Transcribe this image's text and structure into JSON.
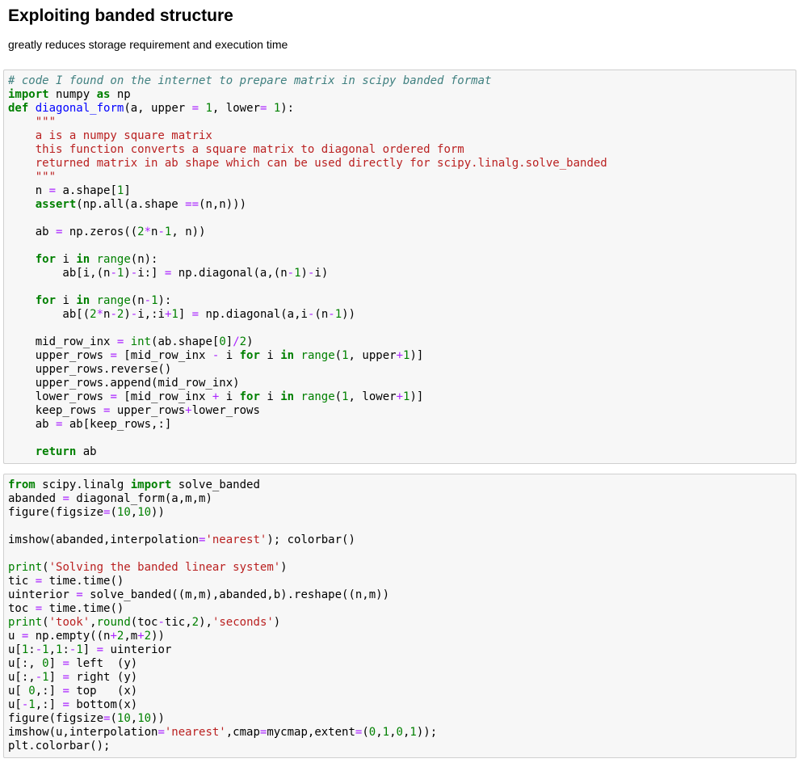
{
  "markdown": {
    "title": "Exploiting banded structure",
    "subtitle": "greatly reduces storage requirement and execution time"
  },
  "cells": [
    {
      "lines": [
        [
          [
            "cm",
            "# code I found on the internet to prepare matrix in scipy banded format"
          ]
        ],
        [
          [
            "kw",
            "import"
          ],
          [
            "",
            " numpy "
          ],
          [
            "kw",
            "as"
          ],
          [
            "",
            " np"
          ]
        ],
        [
          [
            "kw",
            "def"
          ],
          [
            "",
            " "
          ],
          [
            "fn",
            "diagonal_form"
          ],
          [
            "",
            "(a, upper "
          ],
          [
            "op",
            "="
          ],
          [
            "",
            " "
          ],
          [
            "num",
            "1"
          ],
          [
            "",
            ", lower"
          ],
          [
            "op",
            "="
          ],
          [
            "",
            " "
          ],
          [
            "num",
            "1"
          ],
          [
            "",
            "):"
          ]
        ],
        [
          [
            "",
            "    "
          ],
          [
            "str",
            "\"\"\""
          ]
        ],
        [
          [
            "str",
            "    a is a numpy square matrix"
          ]
        ],
        [
          [
            "str",
            "    this function converts a square matrix to diagonal ordered form"
          ]
        ],
        [
          [
            "str",
            "    returned matrix in ab shape which can be used directly for scipy.linalg.solve_banded"
          ]
        ],
        [
          [
            "str",
            "    \"\"\""
          ]
        ],
        [
          [
            "",
            "    n "
          ],
          [
            "op",
            "="
          ],
          [
            "",
            " a.shape["
          ],
          [
            "num",
            "1"
          ],
          [
            "",
            "]"
          ]
        ],
        [
          [
            "",
            "    "
          ],
          [
            "kw",
            "assert"
          ],
          [
            "",
            "(np.all(a.shape "
          ],
          [
            "op",
            "=="
          ],
          [
            "",
            "(n,n)))"
          ]
        ],
        [
          [
            "",
            ""
          ]
        ],
        [
          [
            "",
            "    ab "
          ],
          [
            "op",
            "="
          ],
          [
            "",
            " np.zeros(("
          ],
          [
            "num",
            "2"
          ],
          [
            "op",
            "*"
          ],
          [
            "",
            "n"
          ],
          [
            "op",
            "-"
          ],
          [
            "num",
            "1"
          ],
          [
            "",
            ", n))"
          ]
        ],
        [
          [
            "",
            ""
          ]
        ],
        [
          [
            "",
            "    "
          ],
          [
            "kw",
            "for"
          ],
          [
            "",
            " i "
          ],
          [
            "kw",
            "in"
          ],
          [
            "",
            " "
          ],
          [
            "bi",
            "range"
          ],
          [
            "",
            "(n):"
          ]
        ],
        [
          [
            "",
            "        ab[i,(n"
          ],
          [
            "op",
            "-"
          ],
          [
            "num",
            "1"
          ],
          [
            "",
            ")"
          ],
          [
            "op",
            "-"
          ],
          [
            "",
            "i:] "
          ],
          [
            "op",
            "="
          ],
          [
            "",
            " np.diagonal(a,(n"
          ],
          [
            "op",
            "-"
          ],
          [
            "num",
            "1"
          ],
          [
            "",
            ")"
          ],
          [
            "op",
            "-"
          ],
          [
            "",
            "i)"
          ]
        ],
        [
          [
            "",
            ""
          ]
        ],
        [
          [
            "",
            "    "
          ],
          [
            "kw",
            "for"
          ],
          [
            "",
            " i "
          ],
          [
            "kw",
            "in"
          ],
          [
            "",
            " "
          ],
          [
            "bi",
            "range"
          ],
          [
            "",
            "(n"
          ],
          [
            "op",
            "-"
          ],
          [
            "num",
            "1"
          ],
          [
            "",
            "):"
          ]
        ],
        [
          [
            "",
            "        ab[("
          ],
          [
            "num",
            "2"
          ],
          [
            "op",
            "*"
          ],
          [
            "",
            "n"
          ],
          [
            "op",
            "-"
          ],
          [
            "num",
            "2"
          ],
          [
            "",
            ")"
          ],
          [
            "op",
            "-"
          ],
          [
            "",
            "i,:i"
          ],
          [
            "op",
            "+"
          ],
          [
            "num",
            "1"
          ],
          [
            "",
            "] "
          ],
          [
            "op",
            "="
          ],
          [
            "",
            " np.diagonal(a,i"
          ],
          [
            "op",
            "-"
          ],
          [
            "",
            "(n"
          ],
          [
            "op",
            "-"
          ],
          [
            "num",
            "1"
          ],
          [
            "",
            "))"
          ]
        ],
        [
          [
            "",
            ""
          ]
        ],
        [
          [
            "",
            "    mid_row_inx "
          ],
          [
            "op",
            "="
          ],
          [
            "",
            " "
          ],
          [
            "bi",
            "int"
          ],
          [
            "",
            "(ab.shape["
          ],
          [
            "num",
            "0"
          ],
          [
            "",
            "]"
          ],
          [
            "op",
            "/"
          ],
          [
            "num",
            "2"
          ],
          [
            "",
            ")"
          ]
        ],
        [
          [
            "",
            "    upper_rows "
          ],
          [
            "op",
            "="
          ],
          [
            "",
            " [mid_row_inx "
          ],
          [
            "op",
            "-"
          ],
          [
            "",
            " i "
          ],
          [
            "kw",
            "for"
          ],
          [
            "",
            " i "
          ],
          [
            "kw",
            "in"
          ],
          [
            "",
            " "
          ],
          [
            "bi",
            "range"
          ],
          [
            "",
            "("
          ],
          [
            "num",
            "1"
          ],
          [
            "",
            ", upper"
          ],
          [
            "op",
            "+"
          ],
          [
            "num",
            "1"
          ],
          [
            "",
            ")]"
          ]
        ],
        [
          [
            "",
            "    upper_rows.reverse()"
          ]
        ],
        [
          [
            "",
            "    upper_rows.append(mid_row_inx)"
          ]
        ],
        [
          [
            "",
            "    lower_rows "
          ],
          [
            "op",
            "="
          ],
          [
            "",
            " [mid_row_inx "
          ],
          [
            "op",
            "+"
          ],
          [
            "",
            " i "
          ],
          [
            "kw",
            "for"
          ],
          [
            "",
            " i "
          ],
          [
            "kw",
            "in"
          ],
          [
            "",
            " "
          ],
          [
            "bi",
            "range"
          ],
          [
            "",
            "("
          ],
          [
            "num",
            "1"
          ],
          [
            "",
            ", lower"
          ],
          [
            "op",
            "+"
          ],
          [
            "num",
            "1"
          ],
          [
            "",
            ")]"
          ]
        ],
        [
          [
            "",
            "    keep_rows "
          ],
          [
            "op",
            "="
          ],
          [
            "",
            " upper_rows"
          ],
          [
            "op",
            "+"
          ],
          [
            "",
            "lower_rows"
          ]
        ],
        [
          [
            "",
            "    ab "
          ],
          [
            "op",
            "="
          ],
          [
            "",
            " ab[keep_rows,:]"
          ]
        ],
        [
          [
            "",
            ""
          ]
        ],
        [
          [
            "",
            "    "
          ],
          [
            "kw",
            "return"
          ],
          [
            "",
            " ab"
          ]
        ]
      ]
    },
    {
      "lines": [
        [
          [
            "kw",
            "from"
          ],
          [
            "",
            " scipy.linalg "
          ],
          [
            "kw",
            "import"
          ],
          [
            "",
            " solve_banded"
          ]
        ],
        [
          [
            "",
            "abanded "
          ],
          [
            "op",
            "="
          ],
          [
            "",
            " diagonal_form(a,m,m)"
          ]
        ],
        [
          [
            "",
            "figure(figsize"
          ],
          [
            "op",
            "="
          ],
          [
            "",
            "("
          ],
          [
            "num",
            "10"
          ],
          [
            "",
            ","
          ],
          [
            "num",
            "10"
          ],
          [
            "",
            "))"
          ]
        ],
        [
          [
            "",
            ""
          ]
        ],
        [
          [
            "",
            "imshow(abanded,interpolation"
          ],
          [
            "op",
            "="
          ],
          [
            "str",
            "'nearest'"
          ],
          [
            "",
            "); colorbar()"
          ]
        ],
        [
          [
            "",
            ""
          ]
        ],
        [
          [
            "bi",
            "print"
          ],
          [
            "",
            "("
          ],
          [
            "str",
            "'Solving the banded linear system'"
          ],
          [
            "",
            ")"
          ]
        ],
        [
          [
            "",
            "tic "
          ],
          [
            "op",
            "="
          ],
          [
            "",
            " time.time()"
          ]
        ],
        [
          [
            "",
            "uinterior "
          ],
          [
            "op",
            "="
          ],
          [
            "",
            " solve_banded((m,m),abanded,b).reshape((n,m))"
          ]
        ],
        [
          [
            "",
            "toc "
          ],
          [
            "op",
            "="
          ],
          [
            "",
            " time.time()"
          ]
        ],
        [
          [
            "bi",
            "print"
          ],
          [
            "",
            "("
          ],
          [
            "str",
            "'took'"
          ],
          [
            "",
            ","
          ],
          [
            "bi",
            "round"
          ],
          [
            "",
            "(toc"
          ],
          [
            "op",
            "-"
          ],
          [
            "",
            "tic,"
          ],
          [
            "num",
            "2"
          ],
          [
            "",
            "),"
          ],
          [
            "str",
            "'seconds'"
          ],
          [
            "",
            ")"
          ]
        ],
        [
          [
            "",
            "u "
          ],
          [
            "op",
            "="
          ],
          [
            "",
            " np.empty((n"
          ],
          [
            "op",
            "+"
          ],
          [
            "num",
            "2"
          ],
          [
            "",
            ",m"
          ],
          [
            "op",
            "+"
          ],
          [
            "num",
            "2"
          ],
          [
            "",
            "))"
          ]
        ],
        [
          [
            "",
            "u["
          ],
          [
            "num",
            "1"
          ],
          [
            "",
            ":"
          ],
          [
            "op",
            "-"
          ],
          [
            "num",
            "1"
          ],
          [
            "",
            ","
          ],
          [
            "num",
            "1"
          ],
          [
            "",
            ":"
          ],
          [
            "op",
            "-"
          ],
          [
            "num",
            "1"
          ],
          [
            "",
            "] "
          ],
          [
            "op",
            "="
          ],
          [
            "",
            " uinterior"
          ]
        ],
        [
          [
            "",
            "u[:, "
          ],
          [
            "num",
            "0"
          ],
          [
            "",
            "] "
          ],
          [
            "op",
            "="
          ],
          [
            "",
            " left  (y)"
          ]
        ],
        [
          [
            "",
            "u[:,"
          ],
          [
            "op",
            "-"
          ],
          [
            "num",
            "1"
          ],
          [
            "",
            "] "
          ],
          [
            "op",
            "="
          ],
          [
            "",
            " right (y)"
          ]
        ],
        [
          [
            "",
            "u[ "
          ],
          [
            "num",
            "0"
          ],
          [
            "",
            ",:] "
          ],
          [
            "op",
            "="
          ],
          [
            "",
            " top   (x)"
          ]
        ],
        [
          [
            "",
            "u["
          ],
          [
            "op",
            "-"
          ],
          [
            "num",
            "1"
          ],
          [
            "",
            ",:] "
          ],
          [
            "op",
            "="
          ],
          [
            "",
            " bottom(x)"
          ]
        ],
        [
          [
            "",
            "figure(figsize"
          ],
          [
            "op",
            "="
          ],
          [
            "",
            "("
          ],
          [
            "num",
            "10"
          ],
          [
            "",
            ","
          ],
          [
            "num",
            "10"
          ],
          [
            "",
            "))"
          ]
        ],
        [
          [
            "",
            "imshow(u,interpolation"
          ],
          [
            "op",
            "="
          ],
          [
            "str",
            "'nearest'"
          ],
          [
            "",
            ",cmap"
          ],
          [
            "op",
            "="
          ],
          [
            "",
            "mycmap,extent"
          ],
          [
            "op",
            "="
          ],
          [
            "",
            "("
          ],
          [
            "num",
            "0"
          ],
          [
            "",
            ","
          ],
          [
            "num",
            "1"
          ],
          [
            "",
            ","
          ],
          [
            "num",
            "0"
          ],
          [
            "",
            ","
          ],
          [
            "num",
            "1"
          ],
          [
            "",
            "));"
          ]
        ],
        [
          [
            "",
            "plt.colorbar();"
          ]
        ]
      ]
    }
  ]
}
